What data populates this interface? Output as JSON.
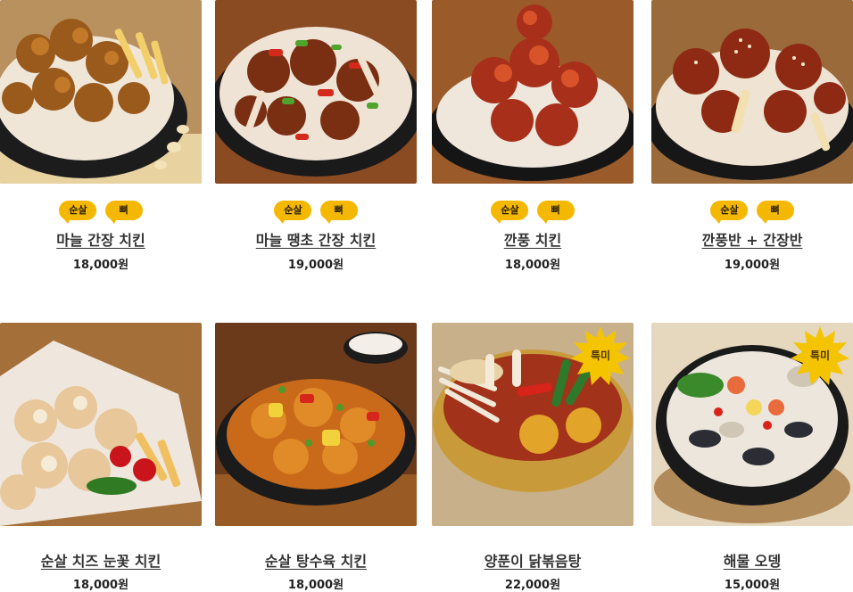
{
  "menu": [
    {
      "name": "마늘 간장 치킨",
      "price": "18,000원",
      "badges": [
        "순살",
        "뼈"
      ]
    },
    {
      "name": "마늘 땡초 간장 치킨",
      "price": "19,000원",
      "badges": [
        "순살",
        "뼈"
      ]
    },
    {
      "name": "깐풍 치킨",
      "price": "18,000원",
      "badges": [
        "순살",
        "뼈"
      ]
    },
    {
      "name": "깐풍반 + 간장반",
      "price": "19,000원",
      "badges": [
        "순살",
        "뼈"
      ]
    },
    {
      "name": "순살 치즈 눈꽃 치킨",
      "price": "18,000원"
    },
    {
      "name": "순살 탕수육 치킨",
      "price": "18,000원"
    },
    {
      "name": "양푼이 닭볶음탕",
      "price": "22,000원",
      "special": "특미"
    },
    {
      "name": "해물 오뎅",
      "price": "15,000원",
      "special": "특미"
    }
  ],
  "colors": {
    "badge": "#f5b800",
    "special": "#f5c400",
    "text": "#333333"
  }
}
